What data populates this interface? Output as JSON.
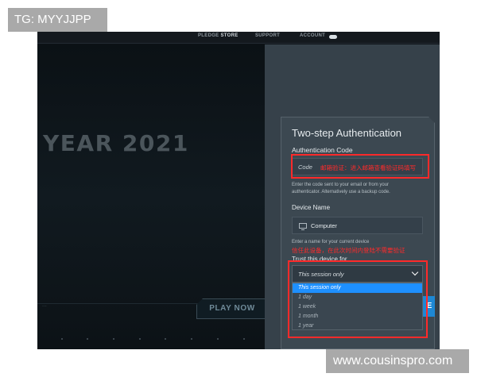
{
  "watermarks": {
    "top_left": "TG: MYYJJPP",
    "bottom_right": "www.cousinspro.com"
  },
  "topnav": {
    "pledge": "PLEDGE",
    "store": "STORE",
    "support": "SUPPORT",
    "account": "ACCOUNT"
  },
  "hero": {
    "title": "YEAR 2021",
    "small_text": "...",
    "play_button": "PLAY NOW"
  },
  "auth": {
    "title": "Two-step Authentication",
    "code_label": "Authentication Code",
    "code_placeholder": "Code",
    "code_note": "邮箱验证：进入邮箱查看验证码填写",
    "code_helper_line1": "Enter the code sent to your email or from your",
    "code_helper_line2": "authenticator. Alternatively use a backup code.",
    "device_label": "Device Name",
    "device_value": "Computer",
    "device_helper": "Enter a name for your current device",
    "trust_note": "信任此设备，在此次时间内登陆不需要验证",
    "trust_label": "Trust this device for",
    "trust_selected": "This session only",
    "trust_options": [
      "This session only",
      "1 day",
      "1 week",
      "1 month",
      "1 year"
    ],
    "continue_partial": "E"
  },
  "colors": {
    "accent": "#1e90ff",
    "annotation_red": "#ff2a2a",
    "panel": "#3c4851",
    "background": "#0d1217"
  },
  "icons": {
    "device": "monitor-icon",
    "dropdown": "chevron-down-icon"
  }
}
